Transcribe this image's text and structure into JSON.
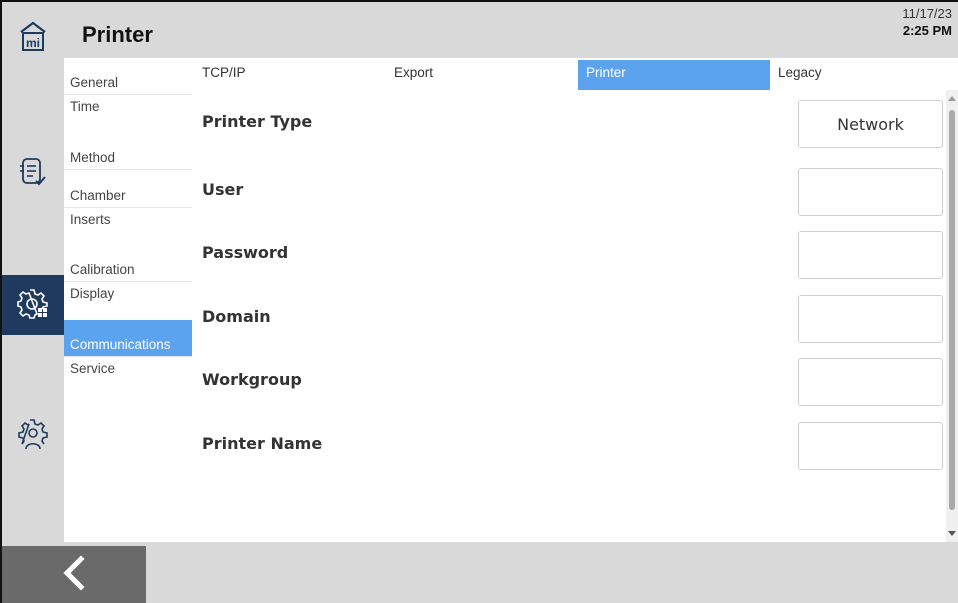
{
  "header": {
    "title": "Printer",
    "date": "11/17/23",
    "time": "2:25 PM"
  },
  "rail": {
    "items": [
      {
        "icon": "home-mi-icon"
      },
      {
        "icon": "method-checklist-icon"
      },
      {
        "icon": "settings-grid-icon",
        "active": true
      },
      {
        "icon": "service-gear-person-icon"
      }
    ]
  },
  "nav": {
    "items": [
      {
        "label": "General"
      },
      {
        "label": "Time"
      },
      {
        "label": "Method"
      },
      {
        "label": "Chamber"
      },
      {
        "label": "Inserts"
      },
      {
        "label": "Calibration"
      },
      {
        "label": "Display"
      },
      {
        "label": "Communications",
        "selected": true
      },
      {
        "label": "Service"
      }
    ]
  },
  "tabs": [
    {
      "label": "TCP/IP"
    },
    {
      "label": "Export"
    },
    {
      "label": "Printer",
      "selected": true
    },
    {
      "label": "Legacy"
    }
  ],
  "form": {
    "printer_type": {
      "label": "Printer Type",
      "value": "Network"
    },
    "user": {
      "label": "User",
      "value": ""
    },
    "password": {
      "label": "Password",
      "value": ""
    },
    "domain": {
      "label": "Domain",
      "value": ""
    },
    "workgroup": {
      "label": "Workgroup",
      "value": ""
    },
    "printer_name": {
      "label": "Printer Name",
      "value": ""
    }
  },
  "footer": {
    "back_icon": "chevron-left-icon"
  },
  "colors": {
    "accent": "#5ba3ee",
    "rail_active": "#1e3a5f",
    "chrome": "#d9d9d9",
    "back_button": "#6a6a6a"
  }
}
